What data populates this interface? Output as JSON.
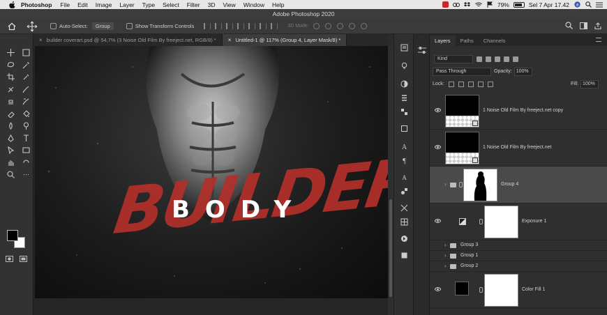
{
  "menubar": {
    "app_name": "Photoshop",
    "items": [
      "File",
      "Edit",
      "Image",
      "Layer",
      "Type",
      "Select",
      "Filter",
      "3D",
      "View",
      "Window",
      "Help"
    ],
    "battery": "79%",
    "datetime": "Sel 7 Apr  17.42"
  },
  "window": {
    "title": "Adobe Photoshop 2020"
  },
  "options": {
    "auto_select_label": "Auto-Select:",
    "auto_select_value": "Group",
    "show_transform_label": "Show Transform Controls",
    "mode_3d_label": "3D Mode:"
  },
  "doc_tabs": [
    {
      "label": "builder coverart.psd @ 54,7% (3 Noise Old Film By freeject.net, RGB/8) *",
      "active": false
    },
    {
      "label": "Untitled-1 @ 117% (Group 4, Layer Mask/8) *",
      "active": true
    }
  ],
  "canvas": {
    "headline": "BUILDER",
    "subhead": "BODY",
    "headline_color": "#b3302a"
  },
  "panel": {
    "tabs": [
      "Layers",
      "Paths",
      "Channels"
    ],
    "active_tab": "Layers",
    "filter_kind": "Kind",
    "blend_mode": "Pass Through",
    "opacity_label": "Opacity:",
    "opacity_value": "100%",
    "lock_label": "Lock:",
    "fill_label": "Fill:",
    "fill_value": "100%"
  },
  "layers": [
    {
      "name": "1 Noise Old Film By freeject.net copy",
      "kind": "pixel",
      "visible": true
    },
    {
      "name": "1 Noise Old Film By freeject.net",
      "kind": "pixel",
      "visible": true
    },
    {
      "name": "Group 4",
      "kind": "group-mask",
      "visible": false,
      "selected": true
    },
    {
      "name": "Exposure 1",
      "kind": "adjustment",
      "visible": true
    },
    {
      "name": "Group 3",
      "kind": "group",
      "visible": false
    },
    {
      "name": "Group 1",
      "kind": "group",
      "visible": false
    },
    {
      "name": "Group 2",
      "kind": "group",
      "visible": false
    },
    {
      "name": "Color Fill 1",
      "kind": "fill",
      "visible": true
    }
  ],
  "tools": [
    "move",
    "marquee",
    "lasso",
    "magic-wand",
    "crop",
    "eyedropper",
    "healing",
    "brush",
    "stamp",
    "history-brush",
    "eraser",
    "paint-bucket",
    "blur",
    "dodge",
    "pen",
    "type",
    "path-select",
    "shape",
    "hand",
    "rotate-view",
    "zoom",
    "more"
  ]
}
